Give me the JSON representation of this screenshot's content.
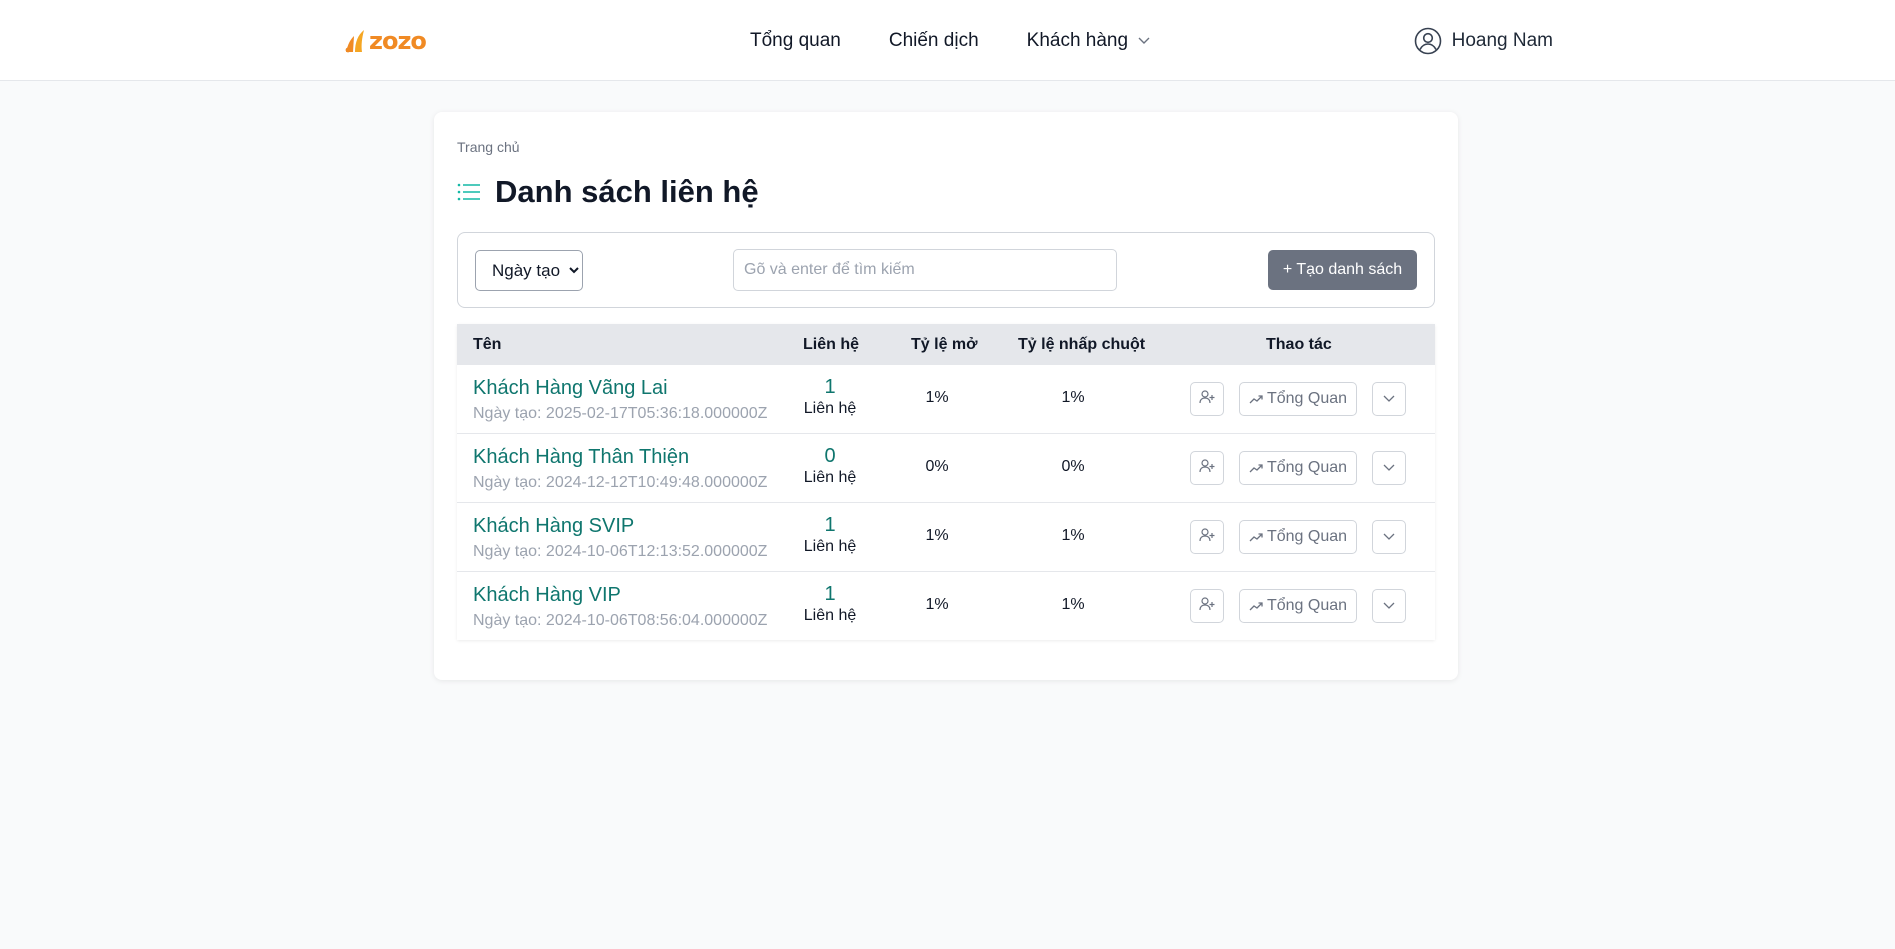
{
  "header": {
    "logo_text": "zozo",
    "nav": [
      {
        "label": "Tổng quan"
      },
      {
        "label": "Chiến dịch"
      },
      {
        "label": "Khách hàng"
      }
    ],
    "user_name": "Hoang Nam"
  },
  "main": {
    "breadcrumb": "Trang chủ",
    "title": "Danh sách liên hệ",
    "sort_selected": "Ngày tạo",
    "search_placeholder": "Gõ và enter để tìm kiếm",
    "create_button": "+ Tạo danh sách"
  },
  "table": {
    "columns": [
      "Tên",
      "Liên hệ",
      "Tỷ lệ mở",
      "Tỷ lệ nhấp chuột",
      "Thao tác"
    ],
    "contacts_label": "Liên hệ",
    "overview_label": "Tổng Quan",
    "rows": [
      {
        "name": "Khách Hàng Vãng Lai",
        "date": "Ngày tạo: 2025-02-17T05:36:18.000000Z",
        "contacts": "1",
        "open_rate": "1%",
        "click_rate": "1%"
      },
      {
        "name": "Khách Hàng Thân Thiện",
        "date": "Ngày tạo: 2024-12-12T10:49:48.000000Z",
        "contacts": "0",
        "open_rate": "0%",
        "click_rate": "0%"
      },
      {
        "name": "Khách Hàng SVIP",
        "date": "Ngày tạo: 2024-10-06T12:13:52.000000Z",
        "contacts": "1",
        "open_rate": "1%",
        "click_rate": "1%"
      },
      {
        "name": "Khách Hàng VIP",
        "date": "Ngày tạo: 2024-10-06T08:56:04.000000Z",
        "contacts": "1",
        "open_rate": "1%",
        "click_rate": "1%"
      }
    ]
  },
  "colors": {
    "accent_teal": "#0f766e",
    "logo_orange": "#f08a24",
    "button_gray": "#6b7280"
  },
  "icons": [
    "zozo-logo-icon",
    "chevron-down-icon",
    "user-circle-icon",
    "list-icon",
    "user-plus-icon",
    "trend-up-icon"
  ]
}
